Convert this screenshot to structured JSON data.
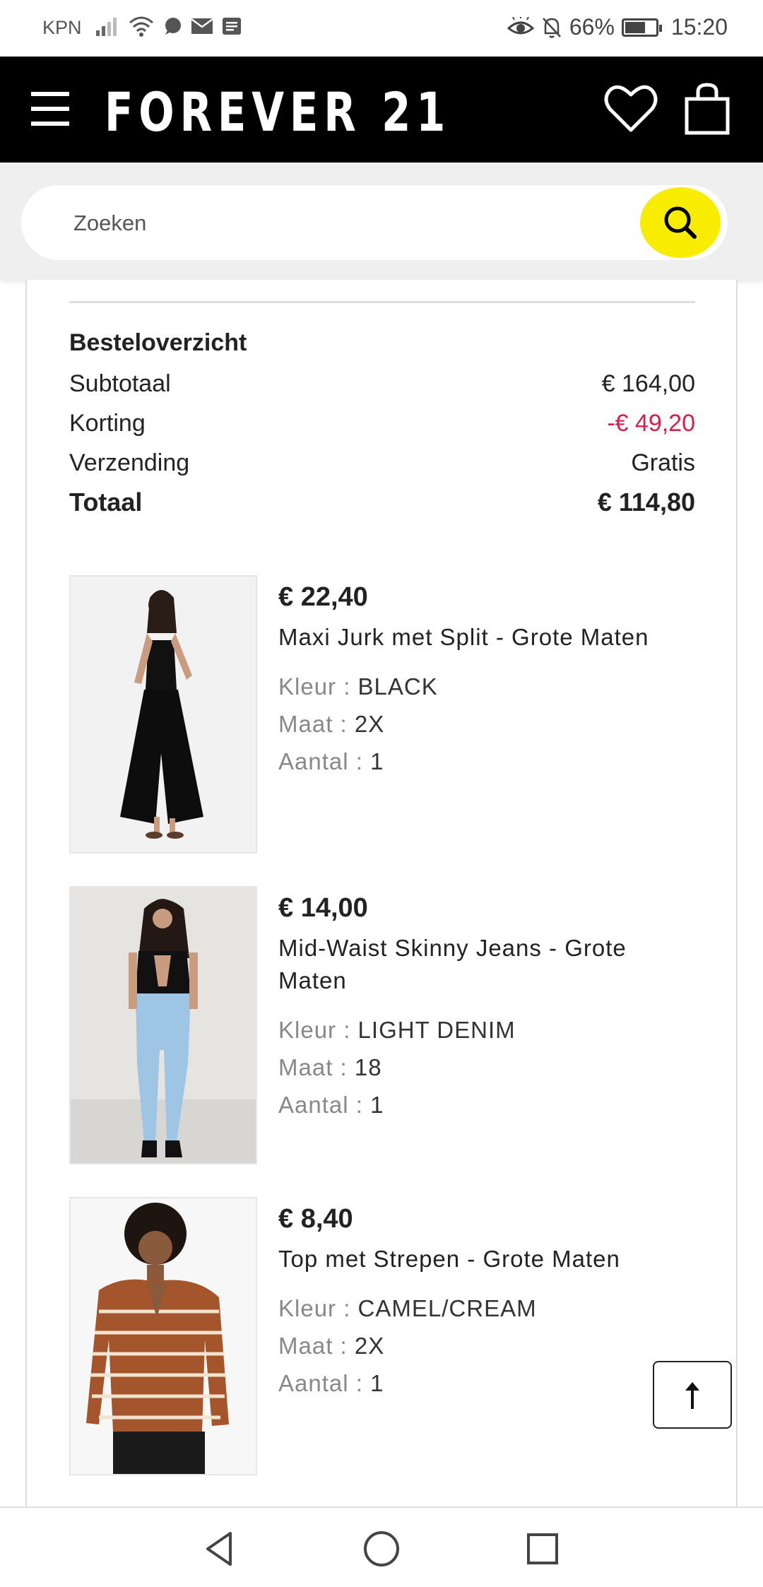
{
  "status_bar": {
    "carrier": "KPN",
    "battery": "66%",
    "time": "15:20"
  },
  "header": {
    "logo": "FOREVER 21"
  },
  "search": {
    "placeholder": "Zoeken"
  },
  "summary": {
    "title": "Besteloverzicht",
    "rows": [
      {
        "label": "Subtotaal",
        "value": "€ 164,00"
      },
      {
        "label": "Korting",
        "value": "-€ 49,20"
      },
      {
        "label": "Verzending",
        "value": "Gratis"
      },
      {
        "label": "Totaal",
        "value": "€ 114,80"
      }
    ]
  },
  "items": [
    {
      "price": "€ 22,40",
      "name": "Maxi Jurk met Split - Grote Maten",
      "color_label": "Kleur : ",
      "color": "BLACK",
      "size_label": "Maat : ",
      "size": "2X",
      "qty_label": "Aantal : ",
      "qty": "1"
    },
    {
      "price": "€ 14,00",
      "name": "Mid-Waist Skinny Jeans - Grote Maten",
      "color_label": "Kleur : ",
      "color": "LIGHT DENIM",
      "size_label": "Maat : ",
      "size": "18",
      "qty_label": "Aantal : ",
      "qty": "1"
    },
    {
      "price": "€ 8,40",
      "name": "Top met Strepen - Grote Maten",
      "color_label": "Kleur : ",
      "color": "CAMEL/CREAM",
      "size_label": "Maat : ",
      "size": "2X",
      "qty_label": "Aantal : ",
      "qty": "1"
    }
  ],
  "colors": {
    "accent_yellow": "#f8ec00",
    "discount_red": "#d6204a",
    "header_black": "#000000"
  },
  "icons": {
    "menu": "hamburger-icon",
    "wishlist": "heart-icon",
    "cart": "bag-icon",
    "search": "search-icon",
    "scroll_top": "arrow-up-icon"
  }
}
